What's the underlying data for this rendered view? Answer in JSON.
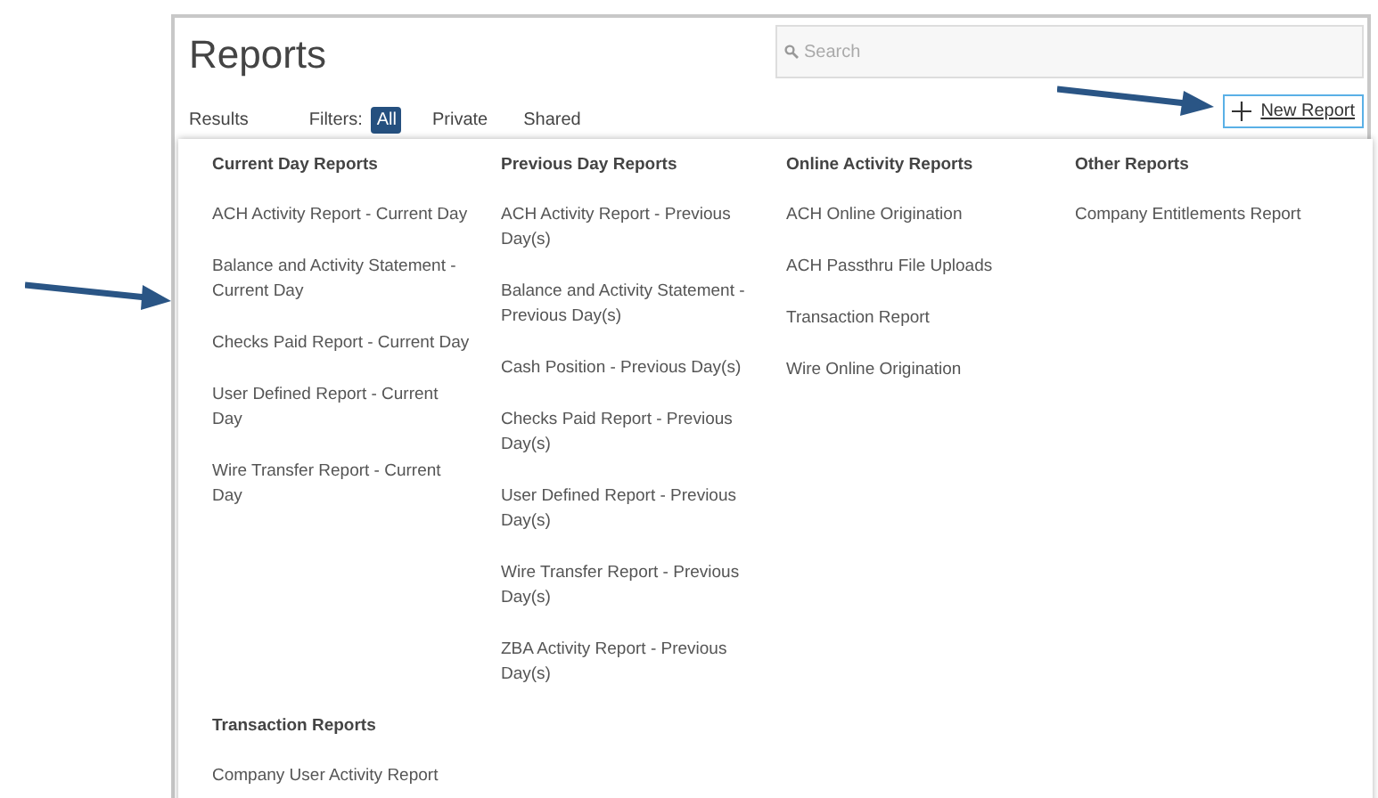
{
  "page": {
    "title": "Reports"
  },
  "search": {
    "placeholder": "Search"
  },
  "results_label": "Results",
  "filters": {
    "label": "Filters:",
    "options": [
      {
        "label": "All",
        "selected": true
      },
      {
        "label": "Private",
        "selected": false
      },
      {
        "label": "Shared",
        "selected": false
      }
    ]
  },
  "new_report_button": {
    "label": "New Report"
  },
  "report_menu": {
    "groups": [
      {
        "heading": "Current Day Reports",
        "items": [
          "ACH Activity Report - Current Day",
          "Balance and Activity Statement - Current Day",
          "Checks Paid Report - Current Day",
          "User Defined Report - Current Day",
          "Wire Transfer Report - Current Day"
        ]
      },
      {
        "heading": "Previous Day Reports",
        "items": [
          "ACH Activity Report - Previous Day(s)",
          "Balance and Activity Statement - Previous Day(s)",
          "Cash Position - Previous Day(s)",
          "Checks Paid Report - Previous Day(s)",
          "User Defined Report - Previous Day(s)",
          "Wire Transfer Report - Previous Day(s)",
          "ZBA Activity Report - Previous Day(s)"
        ]
      },
      {
        "heading": "Online Activity Reports",
        "items": [
          "ACH Online Origination",
          "ACH Passthru File Uploads",
          "Transaction Report",
          "Wire Online Origination"
        ]
      },
      {
        "heading": "Other Reports",
        "items": [
          "Company Entitlements Report"
        ]
      },
      {
        "heading": "Transaction Reports",
        "items": [
          "Company User Activity Report"
        ]
      }
    ]
  }
}
